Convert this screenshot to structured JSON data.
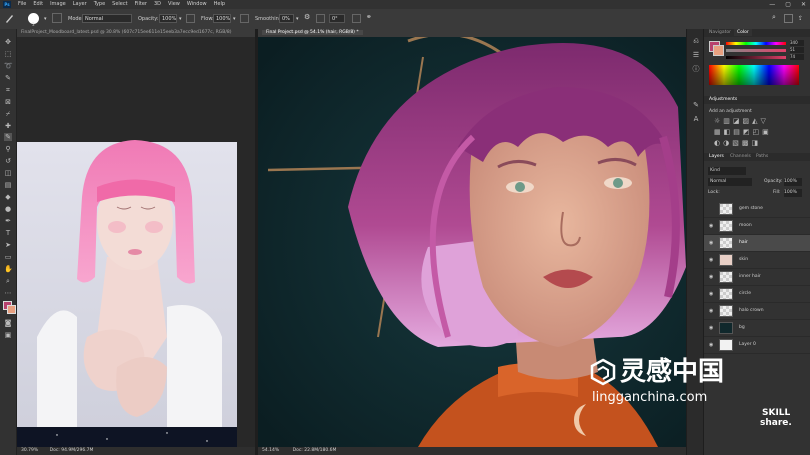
{
  "app": {
    "logo": "Ps"
  },
  "menu": {
    "items": [
      "File",
      "Edit",
      "Image",
      "Layer",
      "Type",
      "Select",
      "Filter",
      "3D",
      "View",
      "Window",
      "Help"
    ],
    "minimize": "—",
    "restore": "▢",
    "close": "✕"
  },
  "options": {
    "brush_size": "3",
    "mode_label": "Mode:",
    "mode_value": "Normal",
    "opacity_label": "Opacity:",
    "opacity_value": "100%",
    "flow_label": "Flow:",
    "flow_value": "100%",
    "smoothing_label": "Smoothing:",
    "smoothing_value": "0%",
    "angle_value": "0°"
  },
  "documents": [
    {
      "tab": "FinalProject_Moodboard_latest.psd @ 30.8% (607c715ee611e15eeb3a7ecc9ed1677c, RGB/8)",
      "zoom": "30.79%",
      "doc": "Doc: 94.9M/296.7M"
    },
    {
      "tab": "Final Project.psd @ 54.1% (hair, RGB/8) *",
      "zoom": "54.14%",
      "doc": "Doc: 22.8M/180.6M"
    }
  ],
  "panels": {
    "navigator_tab": "Navigator",
    "color_tab": "Color",
    "color_values": [
      "340",
      "51",
      "74"
    ],
    "adjustments_title": "Adjustments",
    "adjustments_hint": "Add an adjustment",
    "layers_tabs": [
      "Layers",
      "Channels",
      "Paths"
    ],
    "kind_label": "Kind",
    "blend_mode": "Normal",
    "opacity_label": "Opacity:",
    "opacity_value": "100%",
    "lock_label": "Lock:",
    "fill_label": "Fill:",
    "fill_value": "100%",
    "layers": [
      {
        "name": "gem stone"
      },
      {
        "name": "moon"
      },
      {
        "name": "hair"
      },
      {
        "name": "skin"
      },
      {
        "name": "inner hair"
      },
      {
        "name": "circle"
      },
      {
        "name": "halo crown"
      },
      {
        "name": "bg"
      },
      {
        "name": "Layer 0"
      }
    ]
  },
  "watermark": {
    "cn_text": "灵感中国",
    "url": "lingganchina.com",
    "skill1": "SKILL",
    "skill2": "share."
  },
  "colors": {
    "foreground": "#b8426e",
    "accent_hair": "#c24a8c",
    "canvas_bg": "#10282c"
  }
}
